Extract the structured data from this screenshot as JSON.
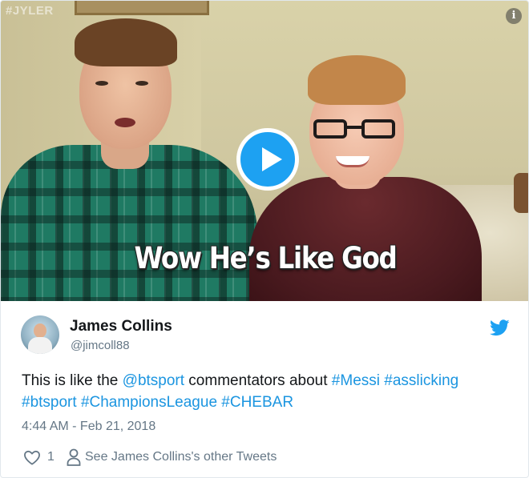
{
  "video": {
    "watermark": "#JYLER",
    "caption": "Wow He’s Like God",
    "info_glyph": "i",
    "play_icon": "play-icon"
  },
  "tweet": {
    "author_name": "James Collins",
    "handle": "@jimcoll88",
    "text_parts": [
      {
        "text": "This is like the ",
        "link": false
      },
      {
        "text": "@btsport",
        "link": true
      },
      {
        "text": " commentators about ",
        "link": false
      },
      {
        "text": "#Messi",
        "link": true
      },
      {
        "text": " ",
        "link": false
      },
      {
        "text": "#asslicking",
        "link": true
      },
      {
        "text": " ",
        "link": false
      },
      {
        "text": "#btsport",
        "link": true
      },
      {
        "text": " ",
        "link": false
      },
      {
        "text": "#ChampionsLeague",
        "link": true
      },
      {
        "text": " ",
        "link": false
      },
      {
        "text": "#CHEBAR",
        "link": true
      }
    ],
    "timestamp": "4:44 AM - Feb 21, 2018",
    "like_count": "1",
    "other_tweets_label": "See James Collins's other Tweets"
  },
  "colors": {
    "link": "#1b95e0",
    "twitter_blue": "#1da1f2",
    "muted": "#657786"
  },
  "icons": [
    "info-icon",
    "play-icon",
    "twitter-bird-icon",
    "heart-icon",
    "person-icon"
  ]
}
